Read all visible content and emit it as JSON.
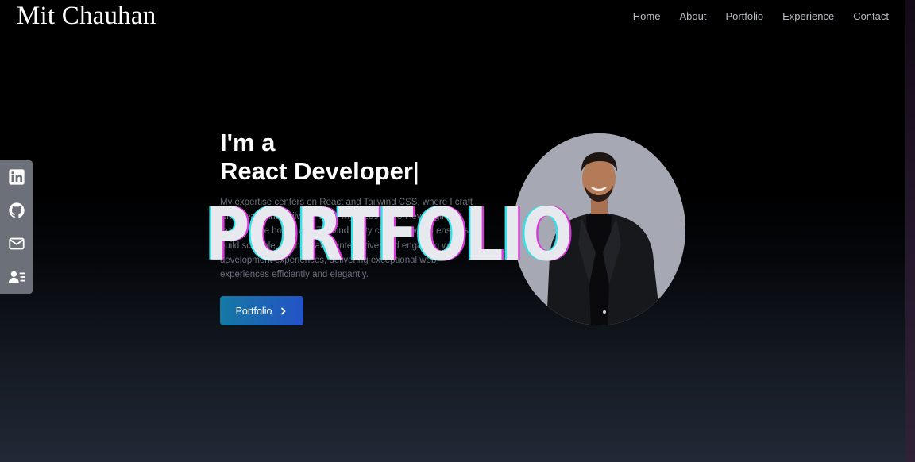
{
  "header": {
    "logo": "Mit Chauhan",
    "nav": [
      "Home",
      "About",
      "Portfolio",
      "Experience",
      "Contact"
    ]
  },
  "social": {
    "icons": [
      "linkedin-icon",
      "github-icon",
      "mail-icon",
      "resume-icon"
    ]
  },
  "hero": {
    "line1": "I'm a",
    "line2": "React Developer",
    "cursor": "|",
    "description": "My expertise centers on React and Tailwind CSS, where I craft with React and Tailwind CSS. My focus lies on leveraging features like hooks and Tailwind utility classes, which ensures I build scalable, maintainable, interactive, and engaging web development experiences, delivering exceptional web experiences efficiently and elegantly.",
    "button_label": "Portfolio",
    "overlay_text": "PORTFOLIO"
  },
  "colors": {
    "accent_start": "#1579a4",
    "accent_end": "#2452c5",
    "photo_bg": "#a6a8b3",
    "overlay_cyan": "#33e2e9",
    "overlay_magenta": "#d836d8"
  }
}
